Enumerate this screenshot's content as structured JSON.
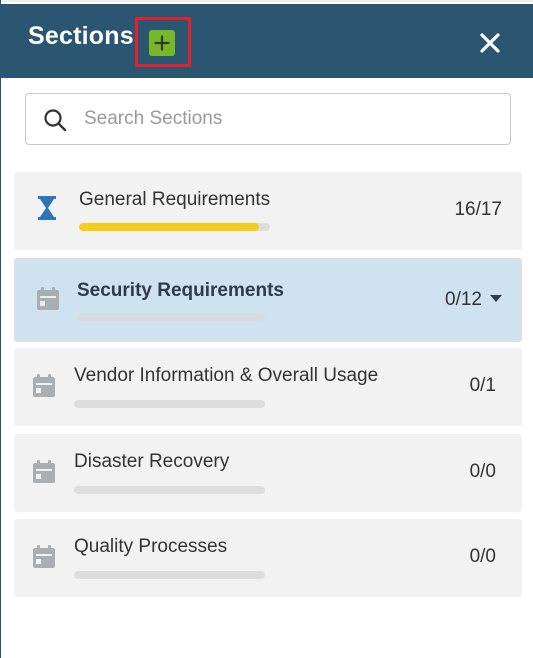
{
  "header": {
    "title": "Sections",
    "add_icon": "plus-icon",
    "close_icon": "close-icon",
    "colors": {
      "background": "#2b5671",
      "add_button": "#76b82a",
      "highlight": "#e3202c"
    }
  },
  "search": {
    "placeholder": "Search Sections",
    "value": ""
  },
  "sections": [
    {
      "title": "General Requirements",
      "count": "16/17",
      "progress": 0.94,
      "icon": "hourglass-icon",
      "selected": false
    },
    {
      "title": "Security Requirements",
      "count": "0/12",
      "progress": 0,
      "icon": "calendar-icon",
      "selected": true
    },
    {
      "title": "Vendor Information & Overall Usage",
      "count": "0/1",
      "progress": 0,
      "icon": "calendar-icon",
      "selected": false
    },
    {
      "title": "Disaster Recovery",
      "count": "0/0",
      "progress": 0,
      "icon": "calendar-icon",
      "selected": false
    },
    {
      "title": "Quality Processes",
      "count": "0/0",
      "progress": 0,
      "icon": "calendar-icon",
      "selected": false
    }
  ]
}
